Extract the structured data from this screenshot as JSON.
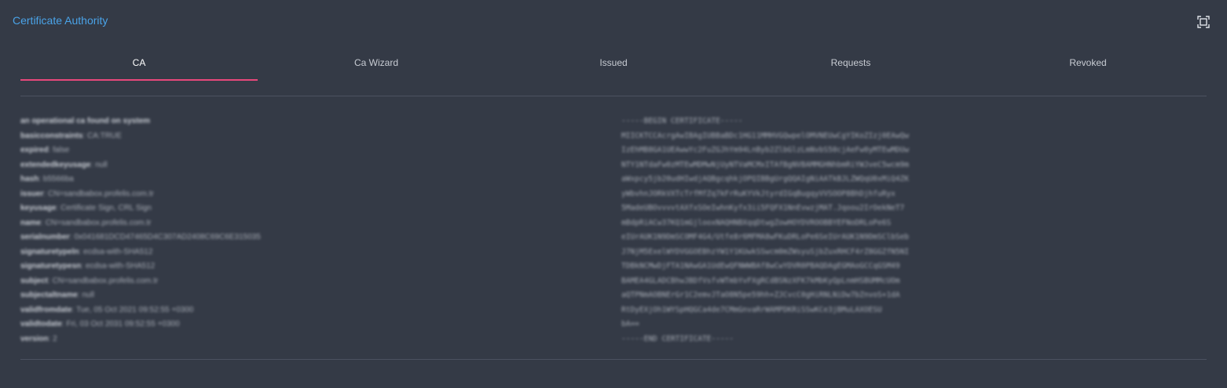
{
  "header": {
    "title": "Certificate Authority"
  },
  "tabs": [
    {
      "label": "CA",
      "active": true
    },
    {
      "label": "Ca Wizard",
      "active": false
    },
    {
      "label": "Issued",
      "active": false
    },
    {
      "label": "Requests",
      "active": false
    },
    {
      "label": "Revoked",
      "active": false
    }
  ],
  "ca_details": [
    {
      "key": "an operational ca found on system",
      "value": ""
    },
    {
      "key": "basicconstraints",
      "value": "CA:TRUE"
    },
    {
      "key": "expired",
      "value": "false"
    },
    {
      "key": "extendedkeyusage",
      "value": "null"
    },
    {
      "key": "hash",
      "value": "b5566ba"
    },
    {
      "key": "issuer",
      "value": "CN=sandbabox.profelis.com.tr"
    },
    {
      "key": "keyusage",
      "value": "Certificate Sign, CRL Sign"
    },
    {
      "key": "name",
      "value": "CN=sandbabox.profelis.com.tr"
    },
    {
      "key": "serialnumber",
      "value": "0x041681DCD47465D4C307AD2408C69C6E315035"
    },
    {
      "key": "signaturetypeln",
      "value": "ecdsa-with-SHA512"
    },
    {
      "key": "signaturetypesn",
      "value": "ecdsa-with-SHA512"
    },
    {
      "key": "subject",
      "value": "CN=sandbabox.profelis.com.tr"
    },
    {
      "key": "subjectaltname",
      "value": "null"
    },
    {
      "key": "validfromdate",
      "value": "Tue, 05 Oct 2021 09:52:55 +0300"
    },
    {
      "key": "validtodate",
      "value": "Fri, 03 Oct 2031 09:52:55 +0300"
    },
    {
      "key": "version",
      "value": "2"
    }
  ],
  "certificate_lines": [
    "-----BEGIN CERTIFICATE-----",
    "MIICKTCCAcrgAwIBAgIUBBaBDc1HG11MMHVGQwpelOMVNEUwCgYIKoZIzj0EAwQw",
    "IzEhMB8GA1UEAwwYc2FuZGJhYm94LnByb2ZlbGlzLmNvbS50cjAeFw0yMTEwMDUw",
    "NTY1NTdaFw0zMTEwMDMwNjUyNTVaMCMxITAfBgNVBAMMGHNhbmRiYWJveC5wcm9m",
    "aWxpcy5jb20udHIwdjAQBgcqhkjOPQIBBgUrgQQAIgNiAATkBJLZWQqU0xMiQ4ZK",
    "yWbvhnJORkVXTcTrfMfZq7kFrRuKYVkJtyrdIGqBugqyVVSOOP8BhDjhfuRyx",
    "5MadeUBOvvvvtAXfxSOeIwhnKyfx3ii5FQFX1NnEvwzjMAT.Jqoou2IrOekNeT7",
    "mBdpRiACw37KQ1mGjlooxNAQHNBXqqDtwgZowHOYDVROOBBYEFNoDRLoPe6S",
    "eIUrAUK1N9DmSCOMF4G4/Utfe8r6MFMA8wFKuDRLoPe6SeIUrAUK1N9DmSClbSeb",
    "J7NjM5ExelWYDVGGOEBhzYW1Y1KUwkSSwcm0mZWsyuSjbZuxRHCF4rZ8GGZfN5NI",
    "TDBkNCMwDjFTA1NAwGA1UdEwQFNWWBAf8wCwYDVR0PBAQDAgEGMAoGCCqGSM49",
    "BAMEA4GLADCBhwJBDfVsfvWTmbYvFXgRCdBSNzXFK7kMbKyQpLnmHSBUMMcUOm",
    "aQTPNmAOBNErGr1C2emvJTaO8N5pe59hh+ZJCvcC0gHiRNLNiDw7bZnvoS+1dA",
    "RtDyEXjOh1WYSpHQGCa4de7CMmGnvaRrWAMPDKRiSSwKCe3jBMuLAXOESU",
    "bA==",
    "-----END CERTIFICATE-----"
  ],
  "icons": {
    "fullscreen": "fullscreen-icon"
  },
  "colors": {
    "title": "#4aa3e8",
    "active_tab_indicator": "#e8487b",
    "background": "#343a46"
  }
}
